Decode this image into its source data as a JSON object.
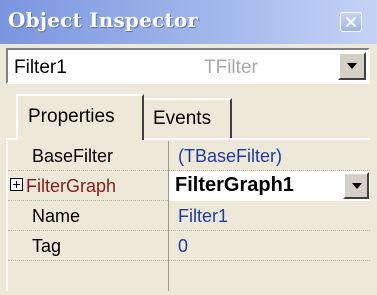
{
  "window": {
    "title": "Object Inspector"
  },
  "object_selector": {
    "name": "Filter1",
    "type": "TFilter"
  },
  "tabs": [
    {
      "label": "Properties",
      "active": true
    },
    {
      "label": "Events",
      "active": false
    }
  ],
  "properties": [
    {
      "name": "BaseFilter",
      "value": "(TBaseFilter)"
    },
    {
      "name": "FilterGraph",
      "value": "FilterGraph1",
      "expandable": true,
      "selected": true
    },
    {
      "name": "Name",
      "value": "Filter1"
    },
    {
      "name": "Tag",
      "value": "0"
    }
  ],
  "colors": {
    "title_gradient_start": "#7a96df",
    "title_gradient_end": "#c5d3f6",
    "value_text": "#1f3aa8",
    "subproperty_name": "#8b1a1a",
    "panel_bg": "#ece9d8"
  },
  "icons": [
    "close-icon",
    "dropdown-arrow-icon",
    "expand-plus-icon"
  ]
}
